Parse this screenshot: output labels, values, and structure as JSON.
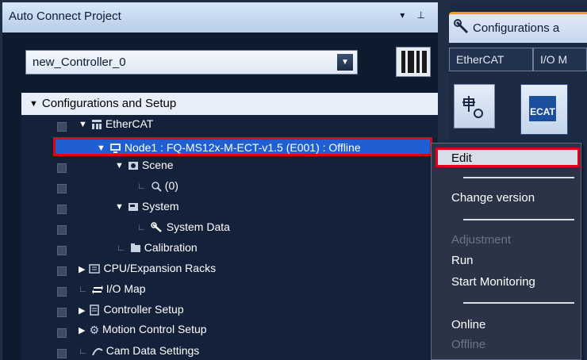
{
  "left_panel": {
    "title": "Auto Connect Project",
    "title_controls": "▾ ⊥",
    "controller_select": {
      "value": "new_Controller_0"
    }
  },
  "tree": {
    "root": "Configurations and Setup",
    "items": [
      {
        "label": "EtherCAT",
        "icon": "ethercat-network-icon"
      },
      {
        "label": "Node1 : FQ-MS12x-M-ECT-v1.5 (E001) : Offline",
        "icon": "node-device-icon",
        "selected": true
      },
      {
        "label": "Scene",
        "icon": "scene-icon"
      },
      {
        "label": "(0)",
        "icon": "scene-item-icon"
      },
      {
        "label": "System",
        "icon": "system-icon"
      },
      {
        "label": "System Data",
        "icon": "wrench-icon"
      },
      {
        "label": "Calibration",
        "icon": "calibration-icon"
      },
      {
        "label": "CPU/Expansion Racks",
        "icon": "racks-icon"
      },
      {
        "label": "I/O Map",
        "icon": "io-map-icon"
      },
      {
        "label": "Controller Setup",
        "icon": "controller-setup-icon"
      },
      {
        "label": "Motion Control Setup",
        "icon": "gear-icon"
      },
      {
        "label": "Cam Data Settings",
        "icon": "cam-data-icon"
      }
    ]
  },
  "right_panel": {
    "tab_label": "Configurations a",
    "subtabs": [
      "EtherCAT",
      "I/O M"
    ],
    "ecat_label": "ECAT"
  },
  "context_menu": {
    "items": [
      {
        "label": "Edit",
        "enabled": true,
        "highlighted": true
      },
      {
        "label": "Change version",
        "enabled": true
      },
      {
        "label": "Adjustment",
        "enabled": false
      },
      {
        "label": "Run",
        "enabled": true
      },
      {
        "label": "Start Monitoring",
        "enabled": true
      },
      {
        "label": "Online",
        "enabled": true
      },
      {
        "label": "Offline",
        "enabled": false
      }
    ]
  },
  "colors": {
    "selection_blue": "#1f5fd1",
    "highlight_red": "#e30019",
    "panel_dark": "#14213a"
  }
}
